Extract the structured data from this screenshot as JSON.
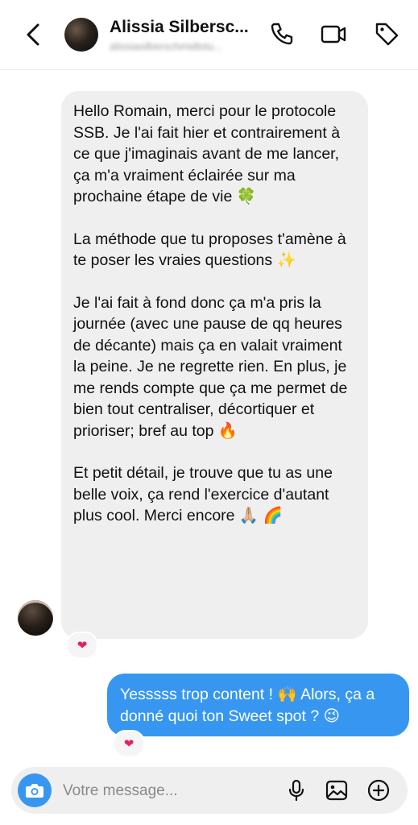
{
  "header": {
    "contact_name": "Alissia Silbersc...",
    "contact_handle": "alissiasilberschmidtstu..."
  },
  "messages": {
    "incoming": {
      "paragraphs": [
        "Hello Romain, merci pour le protocole SSB. Je l'ai fait hier et contrairement à ce que j'imaginais avant de me lancer, ça m'a vraiment éclairée sur ma prochaine étape de vie 🍀",
        "La méthode que tu proposes t'amène à te poser les vraies questions ✨",
        "Je l'ai fait à fond donc ça m'a pris la journée (avec une pause de qq heures de décante) mais ça en valait vraiment la peine. Je ne regrette rien. En plus, je me rends compte que ça me permet de bien tout centraliser, décortiquer et prioriser; bref au top 🔥",
        "Et petit détail, je trouve que tu as une belle voix, ça rend l'exercice d'autant plus cool. Merci encore 🙏🏼 🌈"
      ],
      "reaction": "❤"
    },
    "outgoing": {
      "text": "Yesssss trop content ! 🙌 Alors, ça a donné quoi ton Sweet spot ? 😉",
      "reaction": "❤"
    }
  },
  "composer": {
    "placeholder": "Votre message..."
  },
  "icons": {
    "back": "chevron-left-icon",
    "call": "phone-icon",
    "video": "video-camera-icon",
    "tag": "tag-icon",
    "camera": "camera-icon",
    "mic": "microphone-icon",
    "gallery": "image-icon",
    "add": "plus-circle-icon"
  },
  "colors": {
    "accent": "#3797f0",
    "incoming_bubble": "#efefef",
    "reaction": "#e0245e"
  }
}
